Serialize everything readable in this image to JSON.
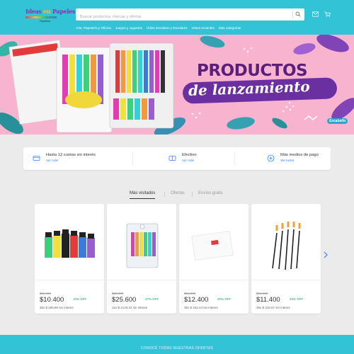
{
  "header": {
    "logo_part1": "Ideas",
    "logo_part2": "en",
    "logo_part3": "Papeles",
    "logo_tagline": "Papelería",
    "search_placeholder": "Buscar productos, marcas y ofertas",
    "nav": [
      "Arte, Papelería y Oficina",
      "Juegos y Juguetes",
      "Útiles escolares y Escolares",
      "Vistos recientes",
      "Más categorías"
    ]
  },
  "banner": {
    "line1": "PRODUCTOS",
    "line2": "de lanzamiento",
    "brand_badge": "Ezcabaño"
  },
  "payments": [
    {
      "title": "Hasta 12 cuotas sin interés",
      "link": "Ver más"
    },
    {
      "title": "Efectivo",
      "link": "Ver más"
    },
    {
      "title": "Más medios de pago",
      "link": "Ver todos"
    }
  ],
  "tabs": [
    "Más visitados",
    "Ofertas",
    "Envíos gratis"
  ],
  "products": [
    {
      "name": "Témperas",
      "old_price": "$11.600",
      "price": "$10.400",
      "discount": "10% OFF",
      "installments": "36x $ 288,89 sin interes"
    },
    {
      "name": "Resaltadores",
      "old_price": "$35.000",
      "price": "$25.600",
      "discount": "27% OFF",
      "installments": "12x $ 2133,33 sin interes"
    },
    {
      "name": "Sobres",
      "old_price": "$15.500",
      "price": "$12.400",
      "discount": "20% OFF",
      "installments": "36x $ 344,44 sin interes"
    },
    {
      "name": "Pinceles",
      "old_price": "$14.000",
      "price": "$11.400",
      "discount": "20% OFF",
      "installments": "36x $ 316,67 sin interes"
    }
  ],
  "footer_text": "CONOCÉ TODAS NUESTRAS OFERTAS",
  "colors": {
    "header": "#33c3d6",
    "banner": "#f8b4cf",
    "accent": "#3483fa",
    "discount": "#00a650"
  }
}
